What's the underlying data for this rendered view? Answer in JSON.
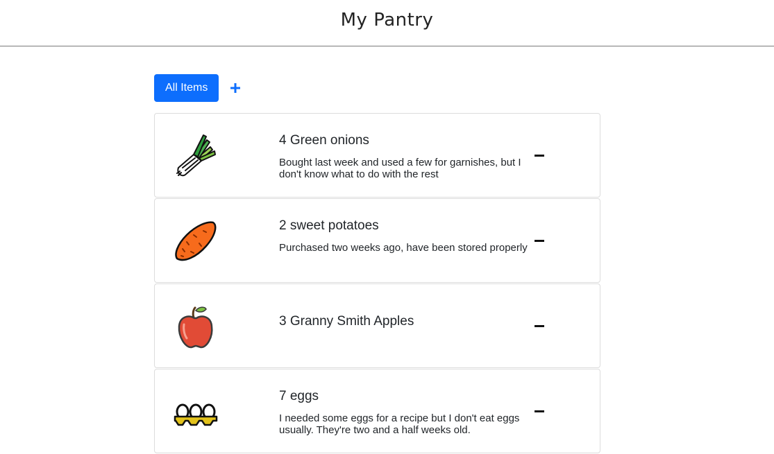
{
  "header": {
    "title": "My Pantry"
  },
  "toolbar": {
    "all_items_label": "All Items",
    "add_icon": "plus-icon",
    "accent_color": "#0d6efd"
  },
  "items": [
    {
      "title": "4 Green onions",
      "description": "Bought last week and used a few for garnishes, but I don't know what to do with the rest",
      "icon": "green-onion-icon"
    },
    {
      "title": "2 sweet potatoes",
      "description": "Purchased two weeks ago, have been stored properly",
      "icon": "sweet-potato-icon"
    },
    {
      "title": "3 Granny Smith Apples",
      "description": "",
      "icon": "apple-icon"
    },
    {
      "title": "7 eggs",
      "description": "I needed some eggs for a recipe but I don't eat eggs usually. They're two and a half weeks old.",
      "icon": "egg-carton-icon"
    }
  ]
}
